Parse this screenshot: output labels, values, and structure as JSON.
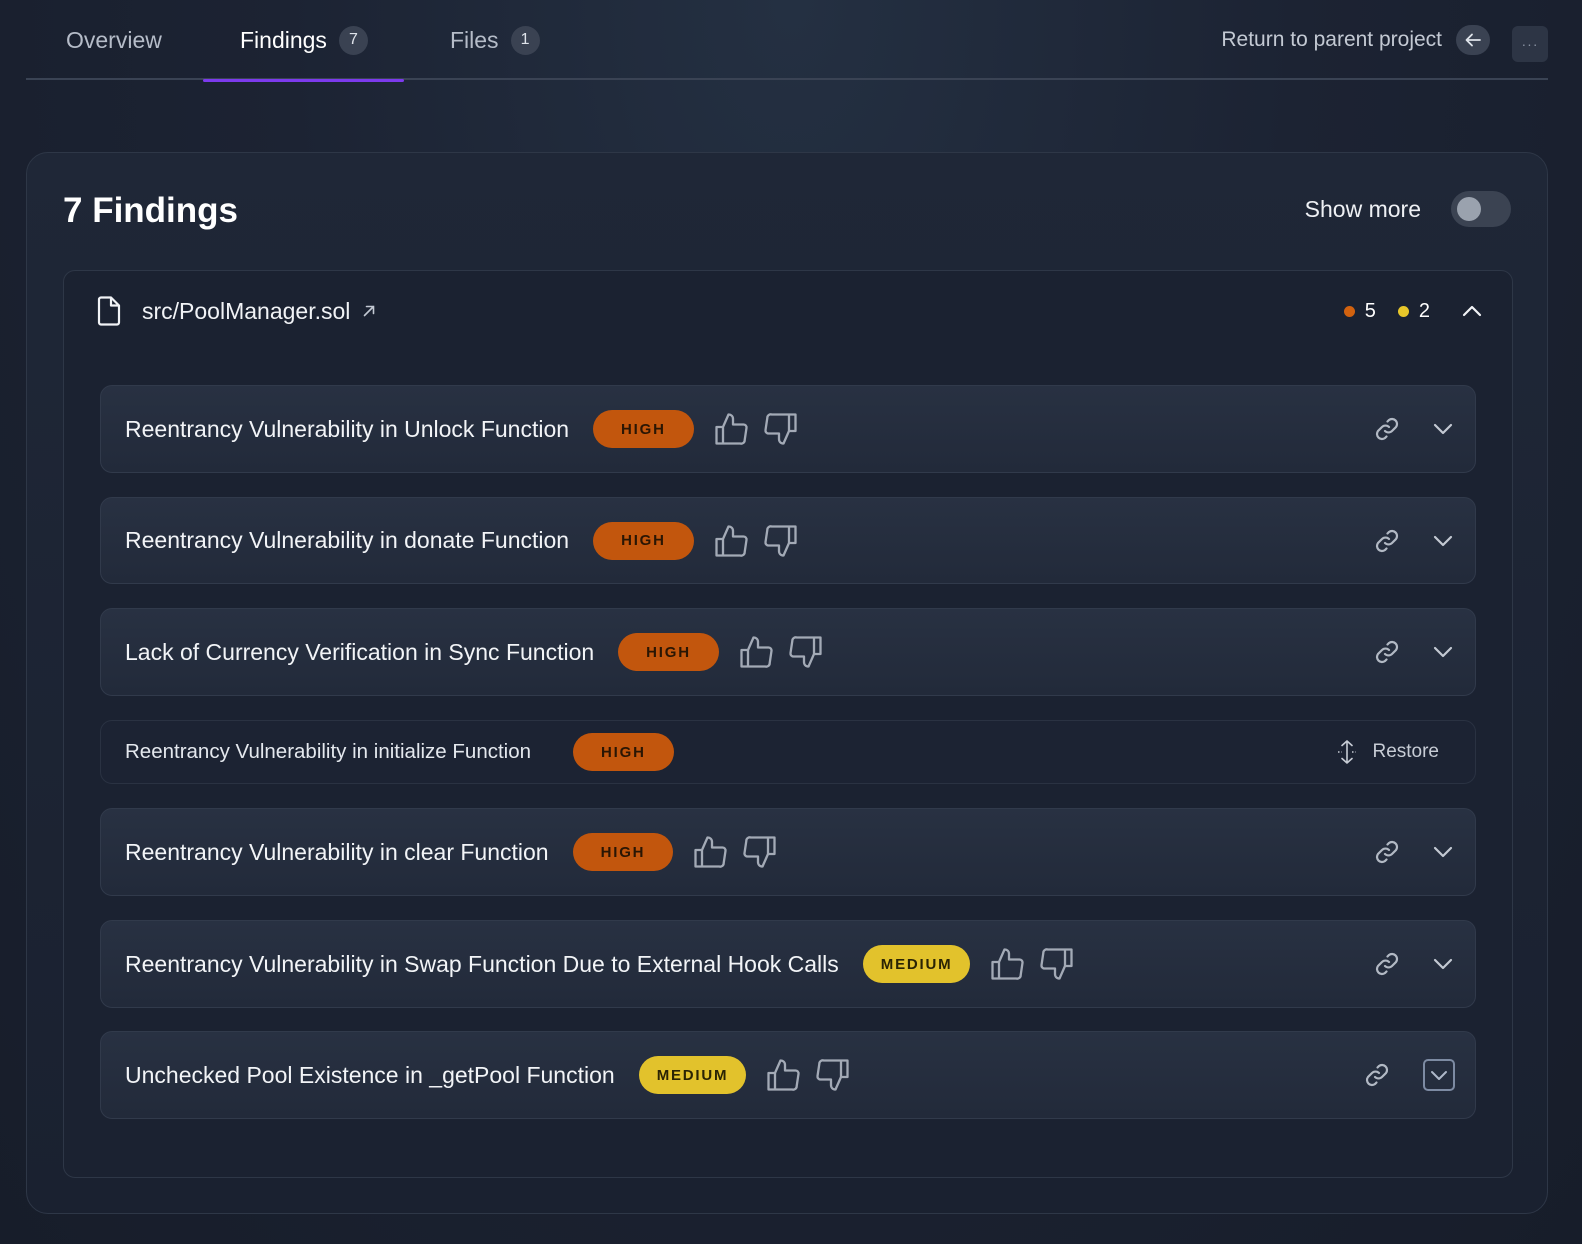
{
  "tabs": [
    {
      "label": "Overview",
      "count": ""
    },
    {
      "label": "Findings",
      "count": "7"
    },
    {
      "label": "Files",
      "count": "1"
    }
  ],
  "header": {
    "return_label": "Return to parent project",
    "more_label": "···"
  },
  "panel": {
    "title": "7 Findings",
    "show_more_label": "Show more",
    "show_more_enabled": false
  },
  "file": {
    "name": "src/PoolManager.sol",
    "high_count": "5",
    "medium_count": "2"
  },
  "colors": {
    "high": "#c2560d",
    "medium": "#e2c22c",
    "accent": "#7c3aed"
  },
  "findings": [
    {
      "title": "Reentrancy Vulnerability in Unlock Function",
      "severity": "HIGH"
    },
    {
      "title": "Reentrancy Vulnerability in donate Function",
      "severity": "HIGH"
    },
    {
      "title": "Lack of Currency Verification in Sync Function",
      "severity": "HIGH"
    },
    {
      "title": "Reentrancy Vulnerability in initialize Function",
      "severity": "HIGH",
      "dismissed": true,
      "restore_label": "Restore"
    },
    {
      "title": "Reentrancy Vulnerability in clear Function",
      "severity": "HIGH"
    },
    {
      "title": "Reentrancy Vulnerability in Swap Function Due to External Hook Calls",
      "severity": "MEDIUM"
    },
    {
      "title": "Unchecked Pool Existence in _getPool Function",
      "severity": "MEDIUM"
    }
  ],
  "icons": {
    "file": "file-icon",
    "external": "external-link-icon",
    "like": "thumbs-up-icon",
    "dislike": "thumbs-down-icon",
    "link": "link-icon",
    "expand": "chevron-down-icon",
    "collapse": "chevron-up-icon",
    "back": "arrow-left-icon",
    "restore": "restore-icon"
  }
}
